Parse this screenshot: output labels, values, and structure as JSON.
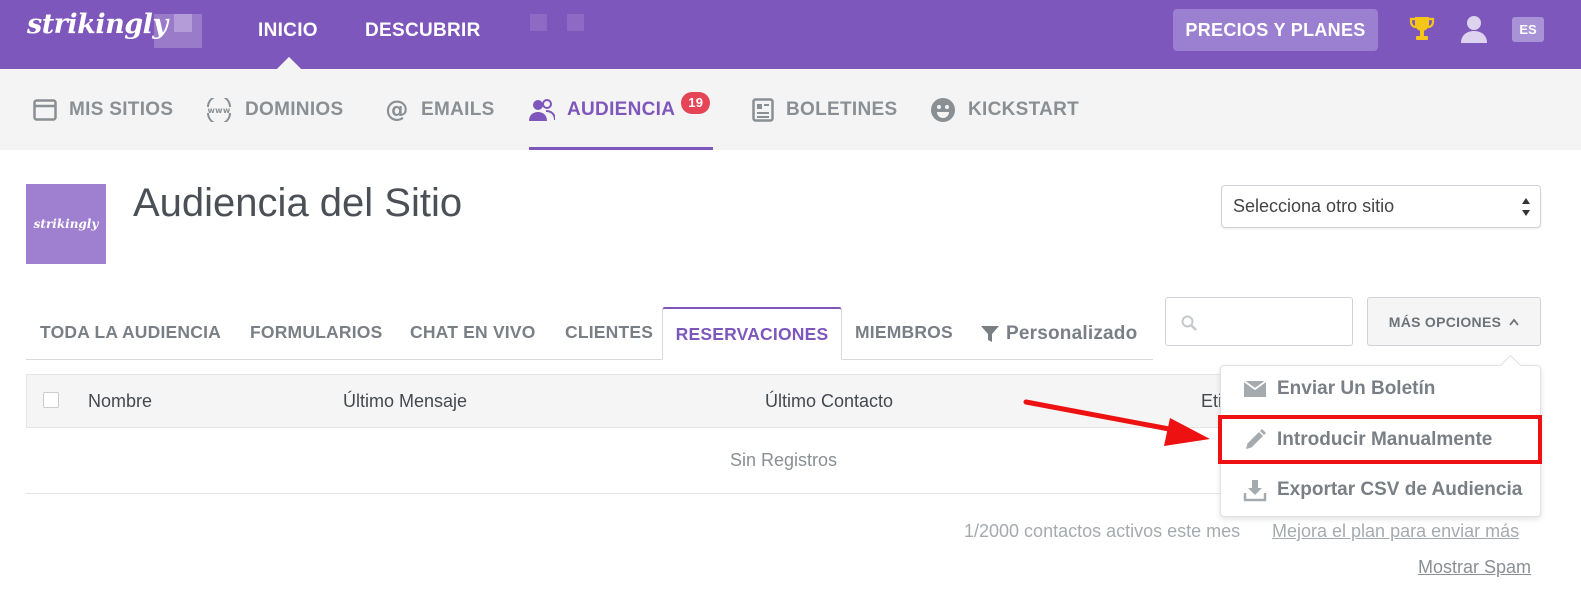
{
  "topbar": {
    "logo": "strikingly",
    "nav": [
      "INICIO",
      "DESCUBRIR"
    ],
    "pricing_button": "PRECIOS Y PLANES",
    "language": "ES",
    "icons": [
      "trophy-icon",
      "user-icon"
    ],
    "color": "#7e57bc"
  },
  "subnav": {
    "items": [
      {
        "label": "MIS SITIOS",
        "icon": "browser-window-icon"
      },
      {
        "label": "DOMINIOS",
        "icon": "www-globe-icon"
      },
      {
        "label": "EMAILS",
        "icon": "at-sign-icon"
      },
      {
        "label": "AUDIENCIA",
        "icon": "people-icon",
        "badge": "19",
        "active": true
      },
      {
        "label": "BOLETINES",
        "icon": "newsletter-icon"
      },
      {
        "label": "KICKSTART",
        "icon": "smiley-icon"
      }
    ]
  },
  "header": {
    "thumbnail_text": "strikingly",
    "title": "Audiencia del Sitio",
    "site_select": "Selecciona otro sitio"
  },
  "tabs": {
    "items": [
      "TODA LA AUDIENCIA",
      "FORMULARIOS",
      "CHAT EN VIVO",
      "CLIENTES",
      "RESERVACIONES",
      "MIEMBROS"
    ],
    "active": "RESERVACIONES",
    "filter": "Personalizado",
    "search_placeholder": "",
    "more_options": "MÁS OPCIONES"
  },
  "table": {
    "columns": [
      "Nombre",
      "Último Mensaje",
      "Último Contacto",
      "Eti"
    ],
    "empty": "Sin Registros"
  },
  "footer": {
    "count": "1/2000 contactos activos este mes",
    "upgrade_link": "Mejora el plan para enviar más",
    "spam_link": "Mostrar Spam"
  },
  "dropdown": {
    "items": [
      {
        "label": "Enviar Un Boletín",
        "icon": "envelope-icon"
      },
      {
        "label": "Introducir Manualmente",
        "icon": "pencil-icon",
        "highlighted": true
      },
      {
        "label": "Exportar CSV de Audiencia",
        "icon": "download-icon"
      }
    ]
  },
  "annotation": {
    "arrow_color": "#ee1111"
  }
}
